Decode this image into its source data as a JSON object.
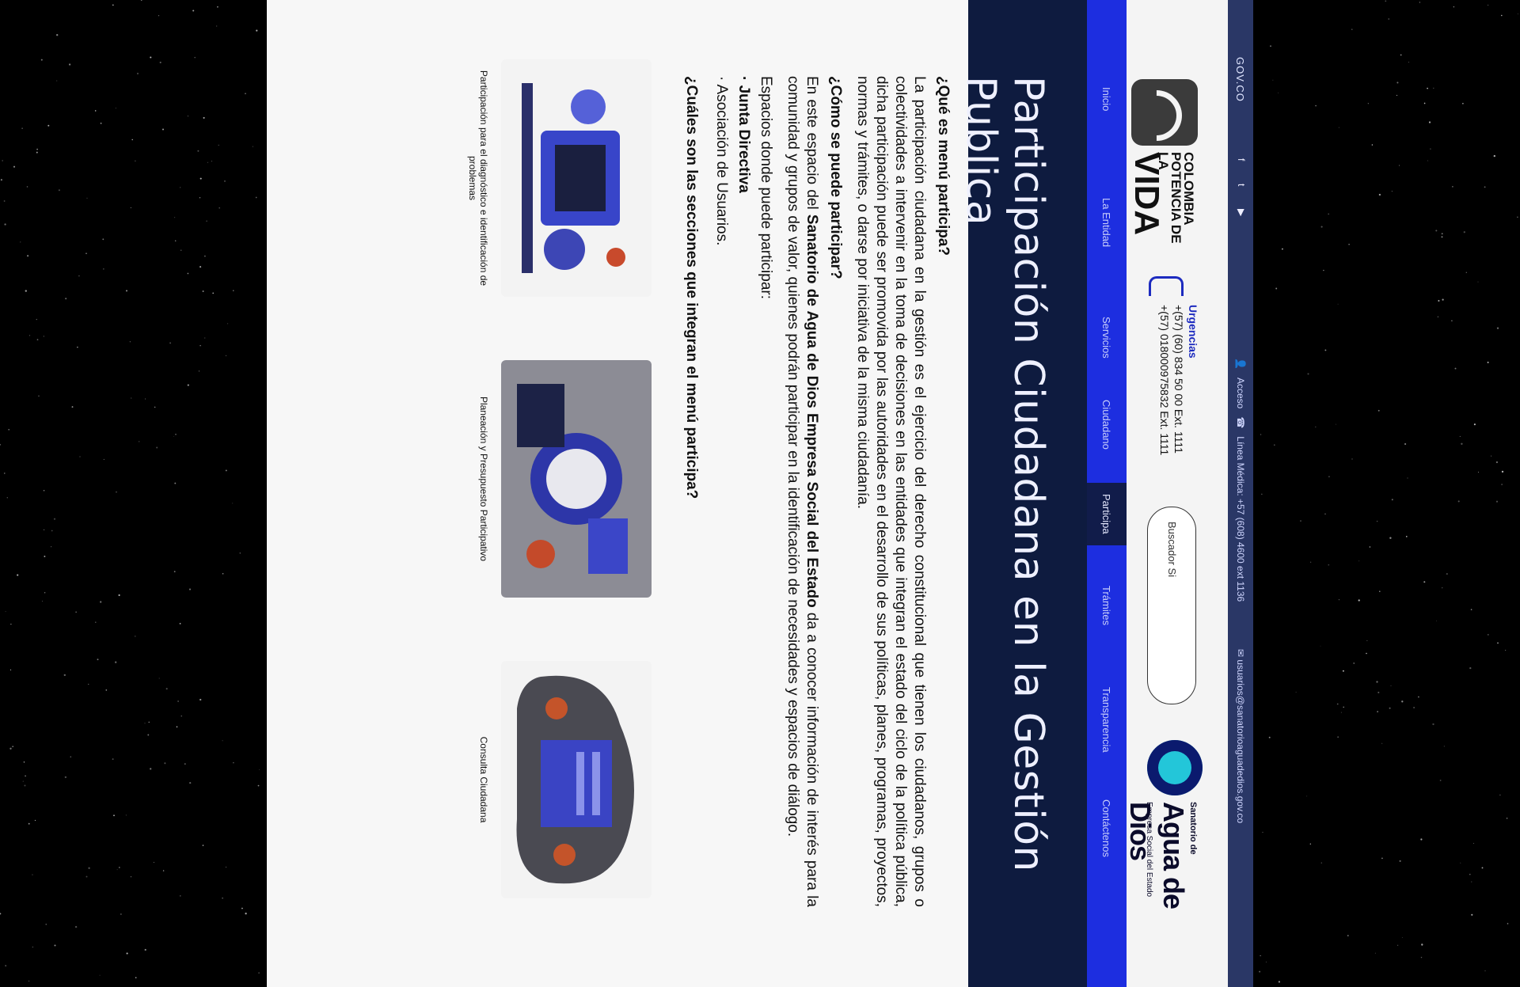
{
  "govbar": {
    "label": "GOV.CO",
    "social": [
      "facebook-icon",
      "twitter-icon",
      "youtube-icon"
    ],
    "access_label": "Acceso",
    "line_label": "Línea Médica: +57 (608) 4600 ext 1136",
    "email": "usuarios@sanatorioaguadedios.gov.co"
  },
  "header": {
    "brand_line1": "COLOMBIA",
    "brand_line2": "POTENCIA DE LA",
    "brand_line3": "VIDA",
    "urgencias_title": "Urgencias",
    "phone1": "+(57) (60) 834 50 00 Ext. 1111",
    "phone2": "+(57) 018000975832 Ext. 1111",
    "search_placeholder": "Buscador Si",
    "org_small": "Sanatorio de",
    "org_big": "Agua de Dios",
    "org_sub": "Empresa Social del Estado"
  },
  "nav": {
    "items": [
      "Inicio",
      "La Entidad",
      "Servicios",
      "Ciudadano",
      "Participa",
      "Trámites",
      "Transparencia",
      "Contáctenos"
    ],
    "active": "Participa"
  },
  "hero": {
    "title": "Participación Ciudadana en la Gestión Publica"
  },
  "content": {
    "h_que": "¿Qué es menú participa?",
    "p_que": "La participación ciudadana en la gestión es el ejercicio del derecho constitucional que tienen los ciudadanos, grupos o colectividades a intervenir en la toma de decisiones en las entidades que integran el estado del ciclo de la política pública, dicha participación puede ser promovida por las autoridades en el desarrollo de sus políticas, planes, programas, proyectos, normas y trámites, o darse por iniciativa de la misma ciudadanía.",
    "h_como": "¿Cómo se puede participar?",
    "p_como_a": "En este espacio del ",
    "p_como_b": "Sanatorio de Agua de Dios Empresa Social del Estado",
    "p_como_c": " da a conocer información de interés para la comunidad y grupos de valor, quienes podrán participar en la identificación de necesidades y espacios de diálogo.",
    "espacios": "Espacios donde puede participar:",
    "list": [
      "· Junta Directiva",
      "· Asociación de Usuarios."
    ],
    "h_cuales": "¿Cuáles son las secciones que integran el menú participa?"
  },
  "cards": [
    {
      "caption": "Participación para el diagnóstico e identificación de problemas"
    },
    {
      "caption": "Planeación y Presupuesto Participativo"
    },
    {
      "caption": "Consulta Ciudadana"
    }
  ]
}
